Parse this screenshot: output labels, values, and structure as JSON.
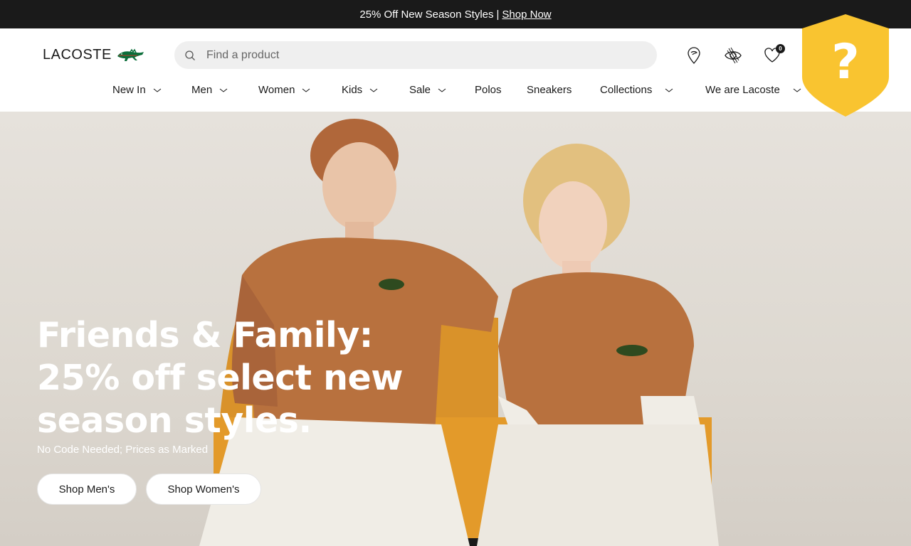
{
  "promo": {
    "text": "25% Off New Season Styles",
    "separator": "|",
    "link": "Shop Now"
  },
  "header": {
    "logo_text": "LACOSTE",
    "search": {
      "placeholder": "Find a product",
      "value": ""
    },
    "icons": [
      "store-locator-icon",
      "eye-accessibility-icon",
      "wishlist-heart-icon"
    ],
    "wishlist_count": "0"
  },
  "nav": {
    "items": [
      {
        "label": "New In",
        "has_dropdown": true
      },
      {
        "label": "Men",
        "has_dropdown": true
      },
      {
        "label": "Women",
        "has_dropdown": true
      },
      {
        "label": "Kids",
        "has_dropdown": true
      },
      {
        "label": "Sale",
        "has_dropdown": true
      },
      {
        "label": "Polos",
        "has_dropdown": false
      },
      {
        "label": "Sneakers",
        "has_dropdown": false
      },
      {
        "label": "Collections",
        "has_dropdown": true
      },
      {
        "label": "We are Lacoste",
        "has_dropdown": true
      }
    ]
  },
  "help_badge": {
    "symbol": "?",
    "color": "#F9C430"
  },
  "hero": {
    "title": "Friends & Family: 25% off select new season styles.",
    "subtitle": "No Code Needed; Prices as Marked",
    "buttons": [
      "Shop Men's",
      "Shop Women's"
    ]
  },
  "colors": {
    "top_bar": "#1A1A1A",
    "search_bg": "#EFEFEF",
    "logo_green": "#0B6E3A",
    "sweater": "#B8713E",
    "couch": "#E39A2A"
  }
}
